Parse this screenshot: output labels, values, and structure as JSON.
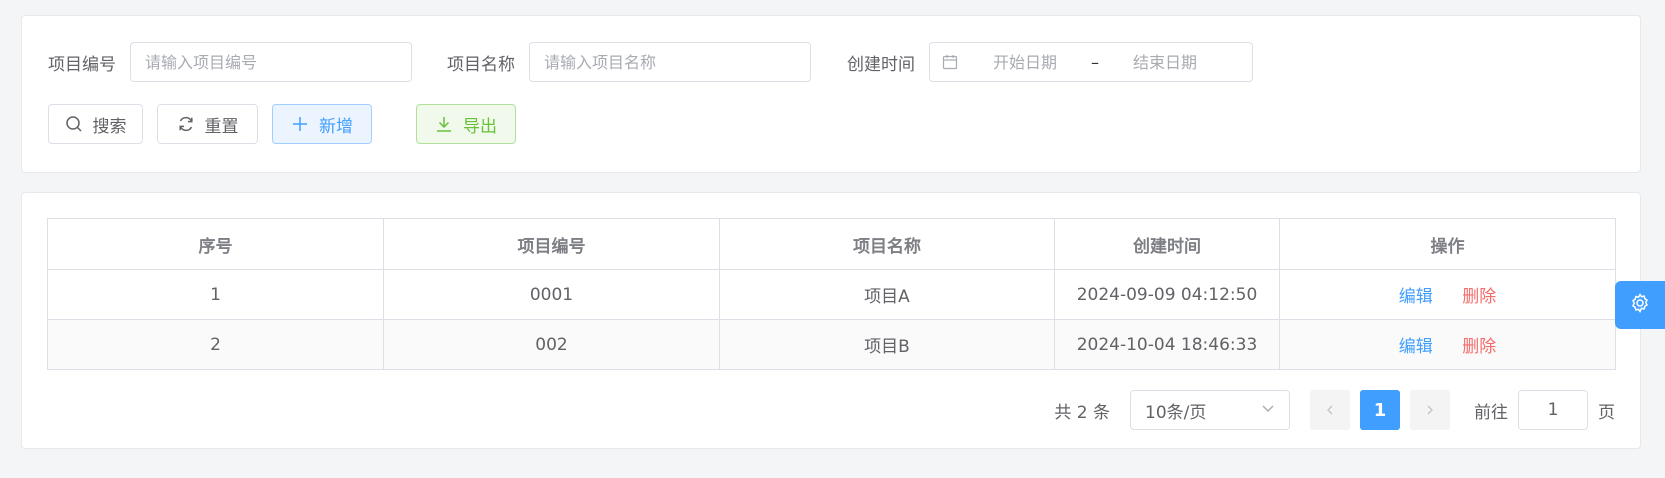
{
  "search": {
    "code_label": "项目编号",
    "code_placeholder": "请输入项目编号",
    "name_label": "项目名称",
    "name_placeholder": "请输入项目名称",
    "time_label": "创建时间",
    "start_placeholder": "开始日期",
    "range_separator": "–",
    "end_placeholder": "结束日期"
  },
  "buttons": {
    "search": "搜索",
    "reset": "重置",
    "add": "新增",
    "export": "导出"
  },
  "table": {
    "headers": [
      "序号",
      "项目编号",
      "项目名称",
      "创建时间",
      "操作"
    ],
    "rows": [
      {
        "index": "1",
        "code": "0001",
        "name": "项目A",
        "created": "2024-09-09 04:12:50",
        "edit": "编辑",
        "delete": "删除"
      },
      {
        "index": "2",
        "code": "002",
        "name": "项目B",
        "created": "2024-10-04 18:46:33",
        "edit": "编辑",
        "delete": "删除"
      }
    ]
  },
  "pagination": {
    "total": "共 2 条",
    "page_size": "10条/页",
    "current_page": "1",
    "goto_label": "前往",
    "goto_value": "1",
    "goto_suffix": "页"
  },
  "colors": {
    "primary": "#409eff",
    "success": "#67c23a",
    "danger": "#f56c6c"
  },
  "icons": {
    "search": "search-icon",
    "reset": "refresh-icon",
    "add": "plus-icon",
    "export": "download-icon",
    "calendar": "calendar-icon",
    "settings": "gear-icon"
  }
}
